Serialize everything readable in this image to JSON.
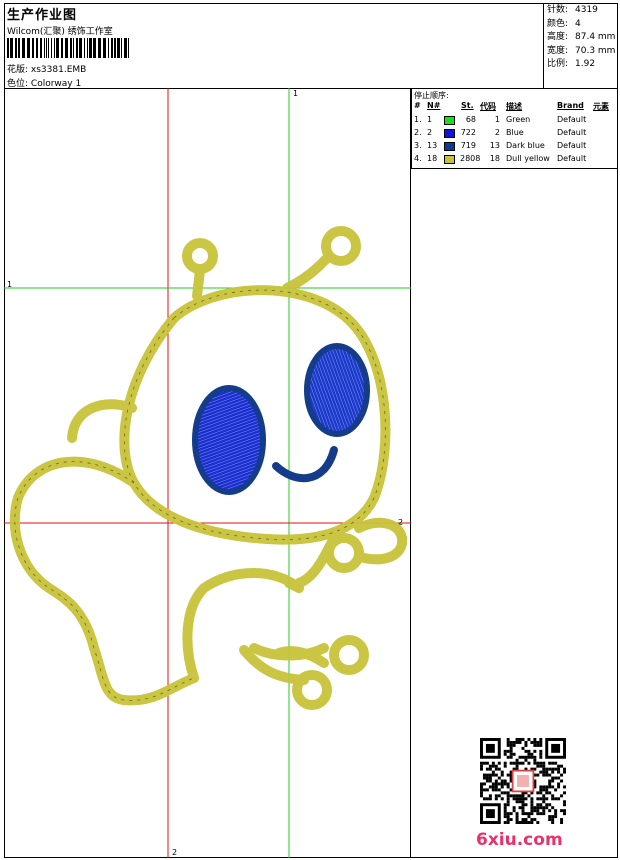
{
  "header": {
    "title": "生产作业图",
    "subtitle": "Wilcom(汇聚) 绣饰工作室",
    "design_label": "花版:",
    "design_value": "xs3381.EMB",
    "colorway_label": "色位:",
    "colorway_value": "Colorway 1"
  },
  "stats": [
    {
      "label": "针数:",
      "value": "4319"
    },
    {
      "label": "颜色:",
      "value": "4"
    },
    {
      "label": "高度:",
      "value": "87.4 mm"
    },
    {
      "label": "宽度:",
      "value": "70.3 mm"
    },
    {
      "label": "比例:",
      "value": "1.92"
    }
  ],
  "color_table": {
    "title": "停止顺序:",
    "headers": {
      "num": "#",
      "n": "N#",
      "st": "St.",
      "code": "代码",
      "desc": "描述",
      "brand": "Brand",
      "element": "元素"
    },
    "rows": [
      {
        "num": "1.",
        "n": "1",
        "color": "#16e316",
        "st": "68",
        "code": "1",
        "desc": "Green",
        "brand": "Default"
      },
      {
        "num": "2.",
        "n": "2",
        "color": "#1212e0",
        "st": "722",
        "code": "2",
        "desc": "Blue",
        "brand": "Default"
      },
      {
        "num": "3.",
        "n": "13",
        "color": "#0c3a8c",
        "st": "719",
        "code": "13",
        "desc": "Dark blue",
        "brand": "Default"
      },
      {
        "num": "4.",
        "n": "18",
        "color": "#c8bf3a",
        "st": "2808",
        "code": "18",
        "desc": "Dull yellow",
        "brand": "Default"
      }
    ]
  },
  "canvas": {
    "guide_labels": {
      "green_top": "1",
      "green_left": "1",
      "red_right": "2",
      "red_bottom": "2"
    },
    "colors": {
      "thread_yellow": "#c8c43a",
      "thread_blue": "#1a2fd0",
      "thread_darkblue": "#143c8a",
      "guide_green": "#22cc22",
      "guide_red": "#e01010"
    }
  },
  "watermark": {
    "brand": "6xiu.com"
  }
}
